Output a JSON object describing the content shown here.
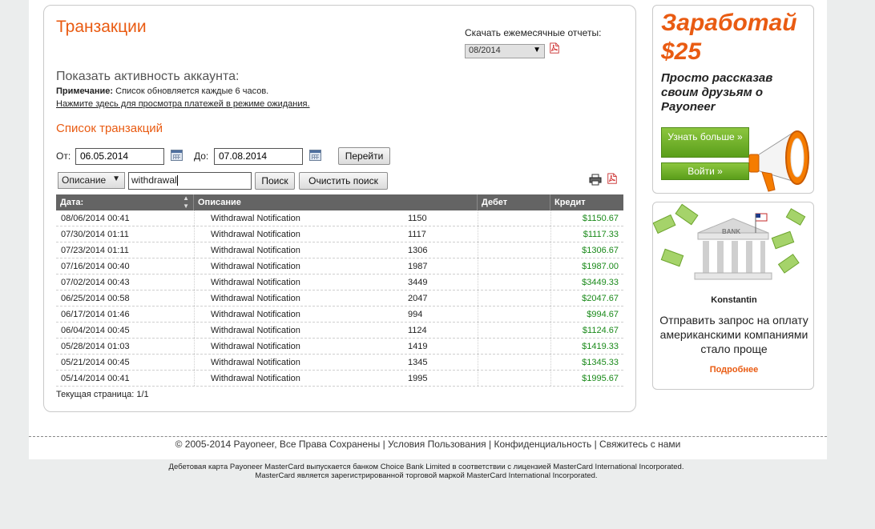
{
  "main": {
    "title": "Транзакции",
    "report_label": "Скачать ежемесячные отчеты:",
    "report_month": "08/2014",
    "activity_heading": "Показать активность аккаунта:",
    "note_label": "Примечание:",
    "note_text": " Список обновляется каждые 6 часов.",
    "pending_link": "Нажмите здесь для просмотра платежей в режиме ожидания.",
    "list_heading": "Список транзакций",
    "from_label": "От:",
    "from_date": "06.05.2014",
    "to_label": "До:",
    "to_date": "07.08.2014",
    "go_button": "Перейти",
    "search_field_select": "Описание",
    "search_value": "withdrawal",
    "search_button": "Поиск",
    "clear_button": "Очистить поиск",
    "page_info": "Текущая страница: 1/1"
  },
  "table": {
    "headers": [
      "Дата:",
      "Описание",
      "Дебет",
      "Кредит"
    ],
    "rows": [
      {
        "date": "08/06/2014 00:41",
        "desc": "Withdrawal Notification",
        "ref": "1150",
        "debit": "",
        "credit": "$1150.67"
      },
      {
        "date": "07/30/2014 01:11",
        "desc": "Withdrawal Notification",
        "ref": "1117",
        "debit": "",
        "credit": "$1117.33"
      },
      {
        "date": "07/23/2014 01:11",
        "desc": "Withdrawal Notification",
        "ref": "1306",
        "debit": "",
        "credit": "$1306.67"
      },
      {
        "date": "07/16/2014 00:40",
        "desc": "Withdrawal Notification",
        "ref": "1987",
        "debit": "",
        "credit": "$1987.00"
      },
      {
        "date": "07/02/2014 00:43",
        "desc": "Withdrawal Notification",
        "ref": "3449",
        "debit": "",
        "credit": "$3449.33"
      },
      {
        "date": "06/25/2014 00:58",
        "desc": "Withdrawal Notification",
        "ref": "2047",
        "debit": "",
        "credit": "$2047.67"
      },
      {
        "date": "06/17/2014 01:46",
        "desc": "Withdrawal Notification",
        "ref": "994",
        "debit": "",
        "credit": "$994.67"
      },
      {
        "date": "06/04/2014 00:45",
        "desc": "Withdrawal Notification",
        "ref": "1124",
        "debit": "",
        "credit": "$1124.67"
      },
      {
        "date": "05/28/2014 01:03",
        "desc": "Withdrawal Notification",
        "ref": "1419",
        "debit": "",
        "credit": "$1419.33"
      },
      {
        "date": "05/21/2014 00:45",
        "desc": "Withdrawal Notification",
        "ref": "1345",
        "debit": "",
        "credit": "$1345.33"
      },
      {
        "date": "05/14/2014 00:41",
        "desc": "Withdrawal Notification",
        "ref": "1995",
        "debit": "",
        "credit": "$1995.67"
      }
    ]
  },
  "promo": {
    "earn_title_line1": "Заработай",
    "earn_title_line2": "$25",
    "earn_sub": "Просто рассказав своим друзьям о Payoneer",
    "learn_more_button": "Узнать больше »",
    "login_button": "Войти »"
  },
  "bank_promo": {
    "bank_label": "BANK",
    "name": "Konstantin",
    "text": "Отправить запрос на оплату американскими компаниями стало проще",
    "more_link": "Подробнее"
  },
  "footer": {
    "copyright": "© 2005-2014 Payoneer, Все Права Сохранены",
    "terms": "Условия Пользования",
    "privacy": "Конфиденциальность",
    "contact": "Свяжитесь с нами",
    "legal_line1": "Дебетовая карта Payoneer MasterCard выпускается банком Choice Bank Limited в соответствии с лицензией MasterCard International Incorporated.",
    "legal_line2": "MasterCard является зарегистрированной торговой маркой MasterCard International Incorporated."
  },
  "colors": {
    "accent": "#e95b12",
    "credit": "#1a8a1a",
    "header_bg": "#646464",
    "button_green": "#6fb22a"
  }
}
